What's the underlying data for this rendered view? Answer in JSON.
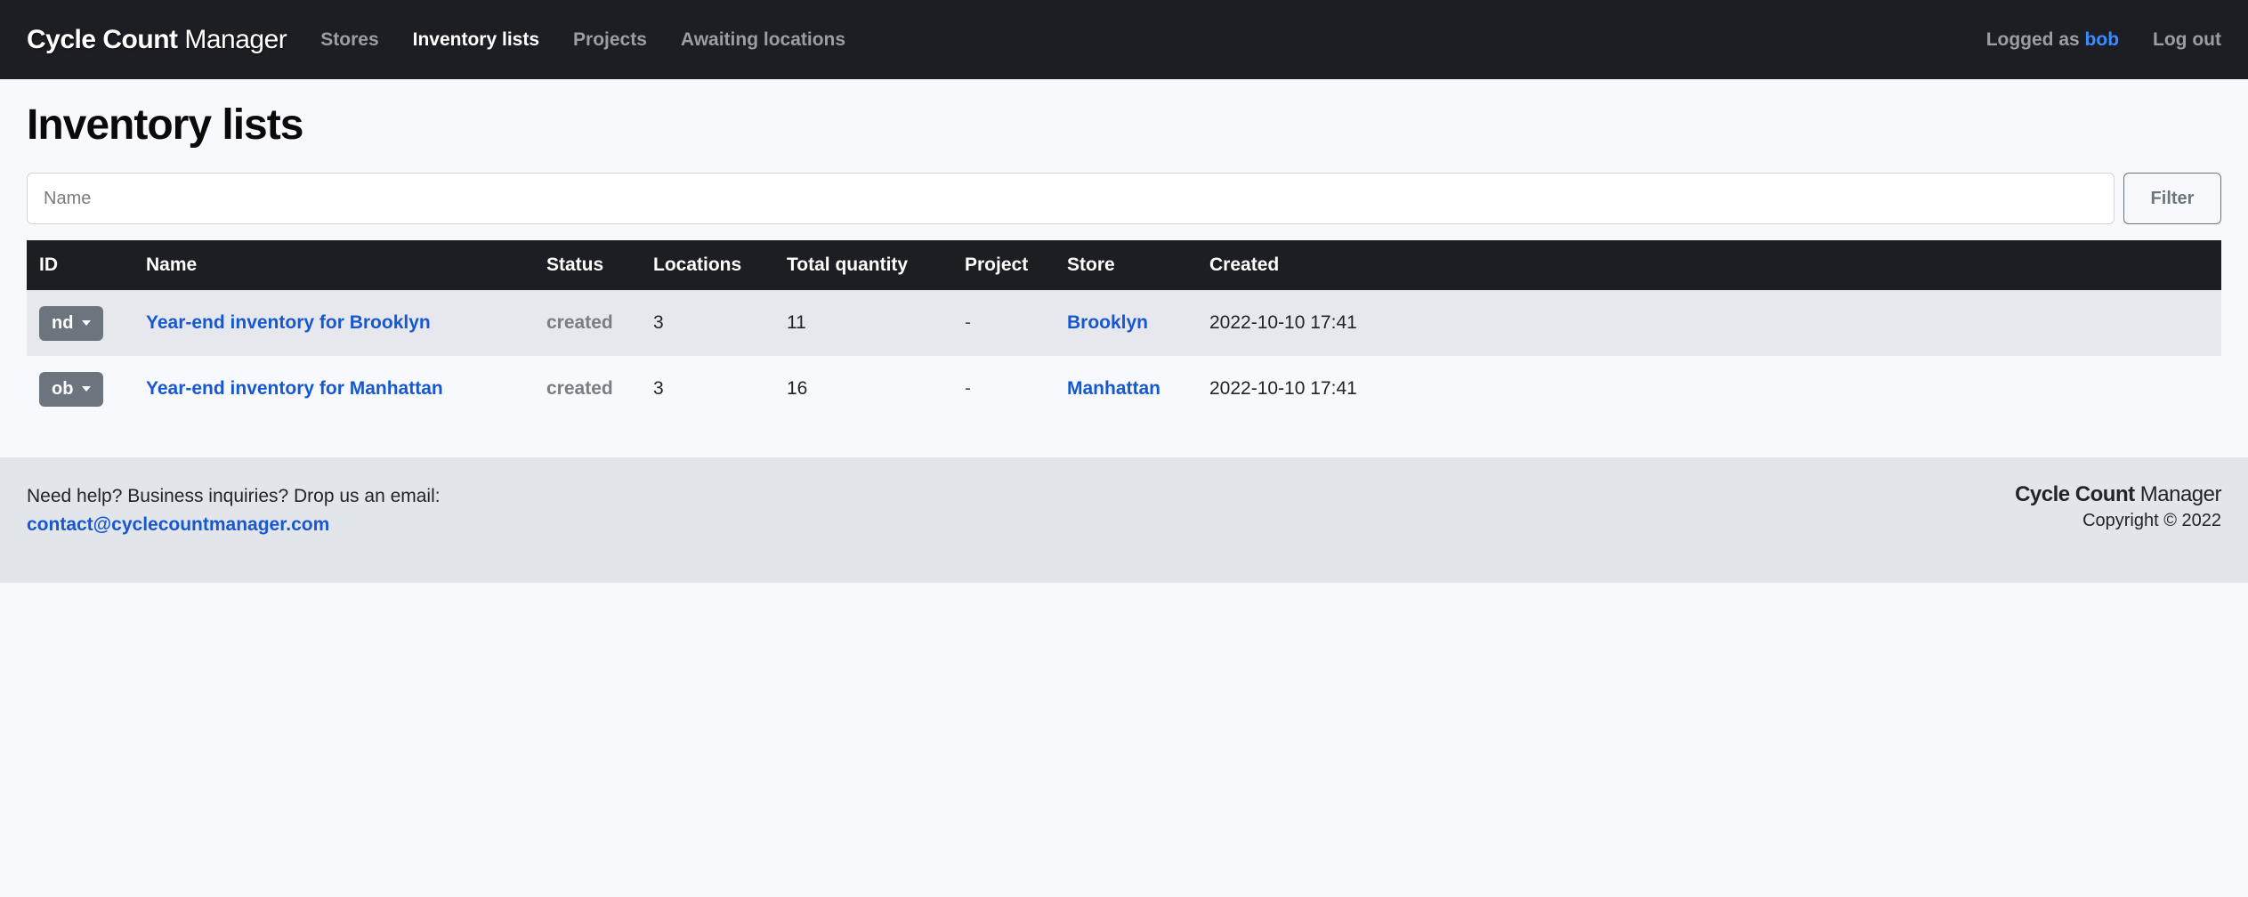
{
  "brand": {
    "bold": "Cycle Count",
    "light": "Manager"
  },
  "nav": {
    "stores": "Stores",
    "inventory_lists": "Inventory lists",
    "projects": "Projects",
    "awaiting_locations": "Awaiting locations"
  },
  "auth": {
    "logged_as_label": "Logged as ",
    "username": "bob",
    "logout": "Log out"
  },
  "page": {
    "title": "Inventory lists"
  },
  "filter": {
    "name_placeholder": "Name",
    "button_label": "Filter"
  },
  "table": {
    "headers": {
      "id": "ID",
      "name": "Name",
      "status": "Status",
      "locations": "Locations",
      "total_quantity": "Total quantity",
      "project": "Project",
      "store": "Store",
      "created": "Created"
    },
    "rows": [
      {
        "id": "nd",
        "name": "Year-end inventory for Brooklyn",
        "status": "created",
        "locations": "3",
        "total_quantity": "11",
        "project": "-",
        "store": "Brooklyn",
        "created": "2022-10-10 17:41"
      },
      {
        "id": "ob",
        "name": "Year-end inventory for Manhattan",
        "status": "created",
        "locations": "3",
        "total_quantity": "16",
        "project": "-",
        "store": "Manhattan",
        "created": "2022-10-10 17:41"
      }
    ]
  },
  "footer": {
    "help_text": "Need help? Business inquiries? Drop us an email:",
    "email": "contact@cyclecountmanager.com",
    "copyright": "Copyright © 2022"
  }
}
